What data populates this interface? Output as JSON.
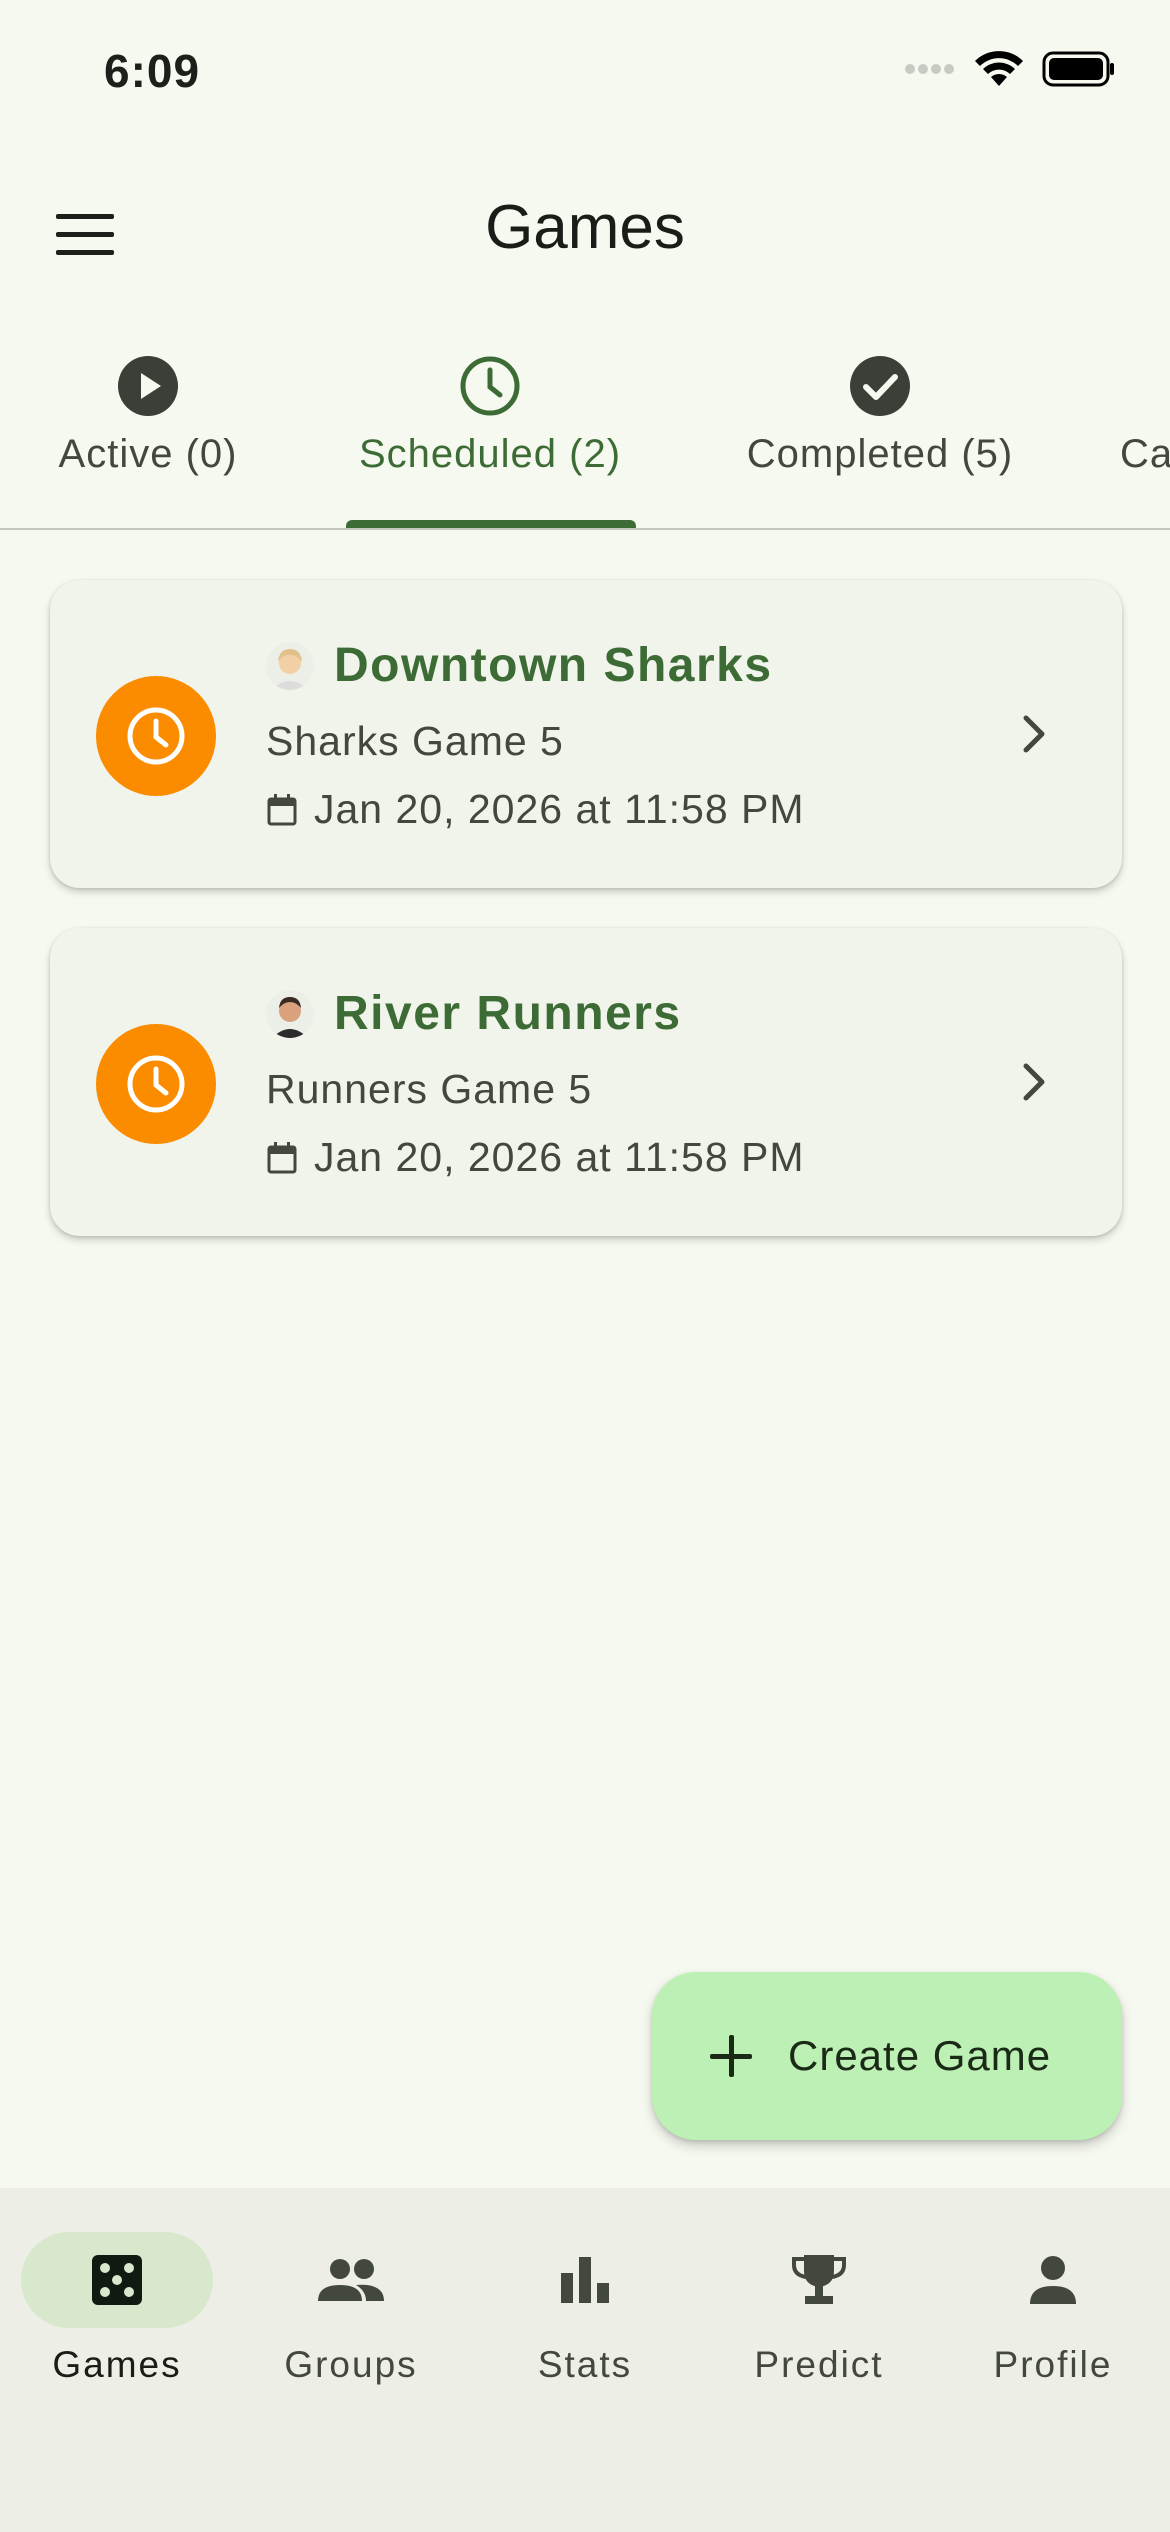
{
  "status_bar": {
    "time": "6:09"
  },
  "app_bar": {
    "title": "Games",
    "menu_icon": "hamburger-menu-icon"
  },
  "tabs": [
    {
      "label": "Active (0)",
      "icon": "play-circle-icon",
      "active": false
    },
    {
      "label": "Scheduled (2)",
      "icon": "clock-icon",
      "active": true
    },
    {
      "label": "Completed (5)",
      "icon": "check-circle-icon",
      "active": false
    },
    {
      "label": "Ca",
      "icon": "",
      "active": false
    }
  ],
  "games": [
    {
      "group": "Downtown Sharks",
      "game": "Sharks Game 5",
      "date": "Jan 20, 2026 at 11:58 PM",
      "avatar": "avatar-blond"
    },
    {
      "group": "River Runners",
      "game": "Runners Game 5",
      "date": "Jan 20, 2026 at 11:58 PM",
      "avatar": "avatar-dark-hair"
    }
  ],
  "fab": {
    "label": "Create Game",
    "icon": "plus-icon"
  },
  "bottom_nav": [
    {
      "label": "Games",
      "icon": "dice-icon",
      "active": true
    },
    {
      "label": "Groups",
      "icon": "people-icon",
      "active": false
    },
    {
      "label": "Stats",
      "icon": "bar-chart-icon",
      "active": false
    },
    {
      "label": "Predict",
      "icon": "trophy-icon",
      "active": false
    },
    {
      "label": "Profile",
      "icon": "person-icon",
      "active": false
    }
  ],
  "colors": {
    "background": "#f6f9f0",
    "primary": "#3d6b35",
    "scheduled_badge": "#fb8c00",
    "fab": "#bcf0b4",
    "nav_indicator": "#d7e8cd"
  }
}
